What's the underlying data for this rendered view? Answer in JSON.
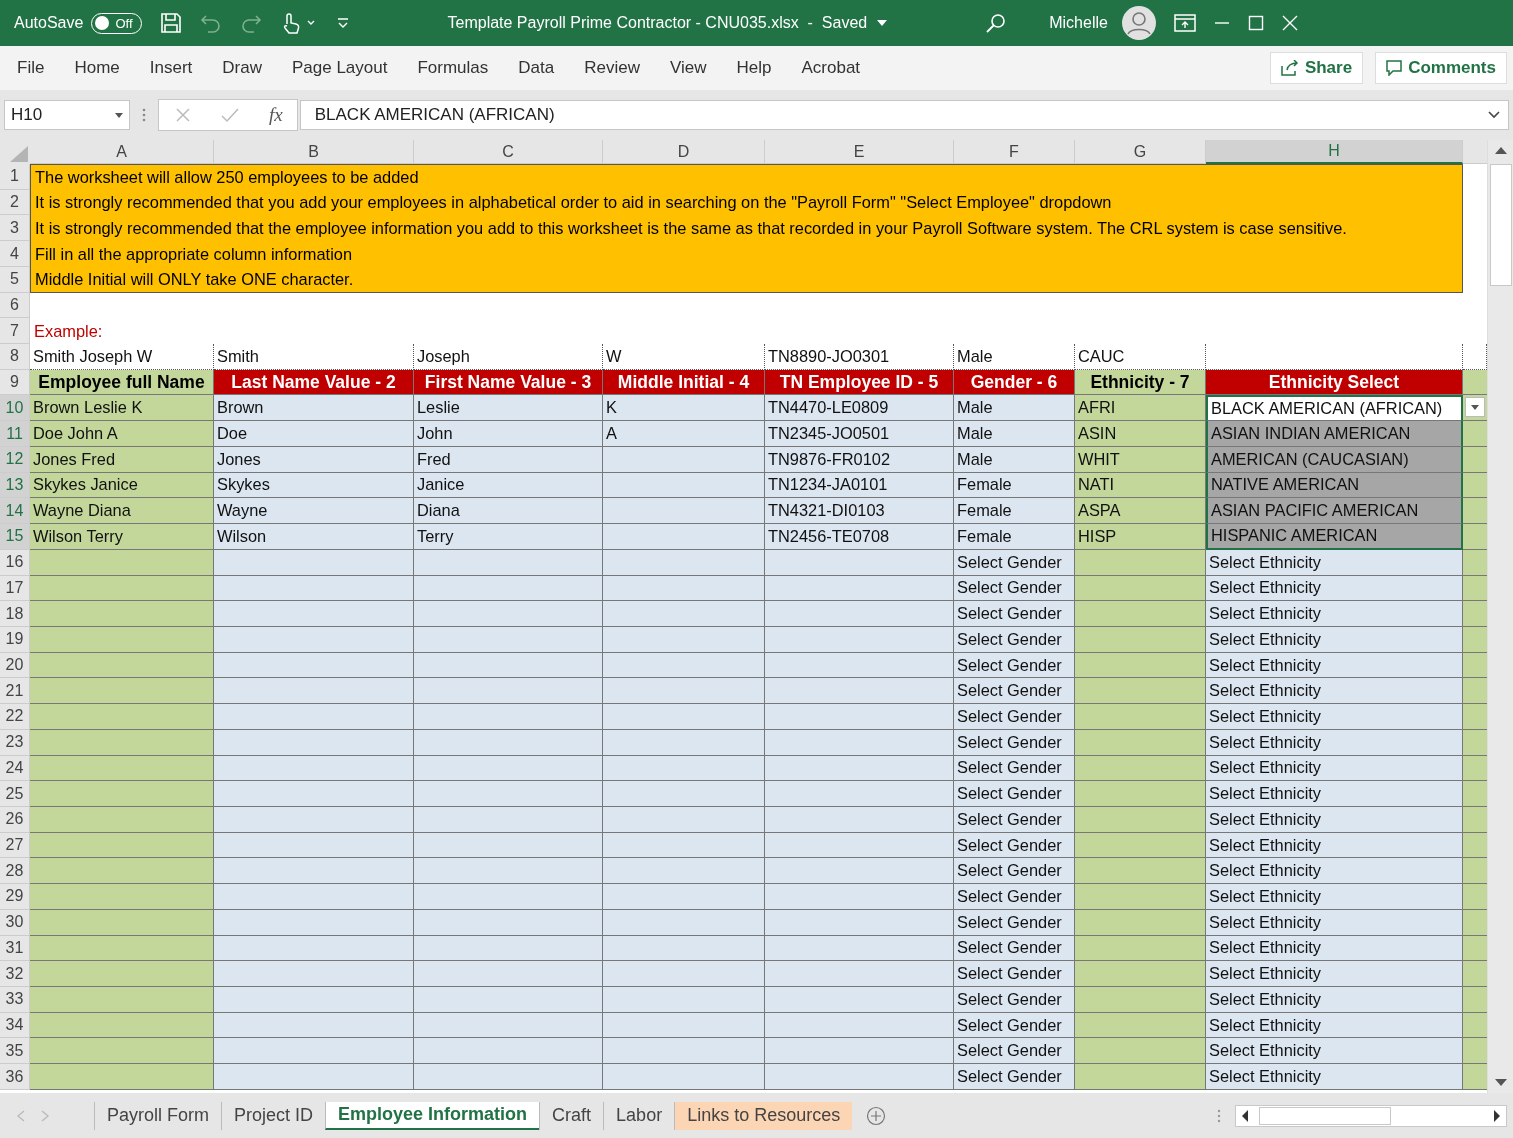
{
  "title_bar": {
    "autosave_label": "AutoSave",
    "autosave_toggle": {
      "label": "Off",
      "on": false
    },
    "title": "Template Payroll Prime Contractor - CNU035.xlsx  -  Saved",
    "user": "Michelle"
  },
  "ribbon": {
    "tabs": [
      {
        "label": "File",
        "selected": false
      },
      {
        "label": "Home",
        "selected": false
      },
      {
        "label": "Insert",
        "selected": false
      },
      {
        "label": "Draw",
        "selected": false
      },
      {
        "label": "Page Layout",
        "selected": false
      },
      {
        "label": "Formulas",
        "selected": false
      },
      {
        "label": "Data",
        "selected": false
      },
      {
        "label": "Review",
        "selected": false
      },
      {
        "label": "View",
        "selected": false
      },
      {
        "label": "Help",
        "selected": false
      },
      {
        "label": "Acrobat",
        "selected": false
      }
    ],
    "share": "Share",
    "comments": "Comments"
  },
  "formula_bar": {
    "name_box": "H10",
    "fx": "fx",
    "value": "BLACK AMERICAN (AFRICAN)"
  },
  "sheet": {
    "columns": [
      {
        "label": "A",
        "selected": false
      },
      {
        "label": "B",
        "selected": false
      },
      {
        "label": "C",
        "selected": false
      },
      {
        "label": "D",
        "selected": false
      },
      {
        "label": "E",
        "selected": false
      },
      {
        "label": "F",
        "selected": false
      },
      {
        "label": "G",
        "selected": false
      },
      {
        "label": "H",
        "selected": true
      }
    ],
    "rows": [
      {
        "num": "1",
        "kind": "note",
        "text": "The worksheet will allow 250 employees to be added"
      },
      {
        "num": "2",
        "kind": "note",
        "text": "It is strongly recommended that you add your employees in alphabetical order to aid in searching on the \"Payroll Form\" \"Select Employee\" dropdown"
      },
      {
        "num": "3",
        "kind": "note",
        "text": "It is strongly recommended that the employee information you add to this worksheet is the same as that recorded in your Payroll Software system.  The CRL system is case sensitive."
      },
      {
        "num": "4",
        "kind": "note",
        "text": "Fill in all the appropriate column information"
      },
      {
        "num": "5",
        "kind": "note",
        "text": "Middle Initial will ONLY take ONE character."
      },
      {
        "num": "6",
        "kind": "blank"
      },
      {
        "num": "7",
        "kind": "label",
        "text": "Example:"
      },
      {
        "num": "8",
        "kind": "example",
        "cells": [
          "Smith Joseph W",
          "Smith",
          "Joseph",
          "W",
          "TN8890-JO0301",
          "Male",
          "CAUC",
          null
        ]
      },
      {
        "num": "9",
        "kind": "header",
        "cells": [
          {
            "text": "Employee full Name",
            "color": "#c4d79b"
          },
          {
            "text": "Last Name Value - 2",
            "color": "#c00000"
          },
          {
            "text": "First Name Value - 3",
            "color": "#c00000"
          },
          {
            "text": "Middle Initial - 4",
            "color": "#c00000"
          },
          {
            "text": "TN Employee ID - 5",
            "color": "#c00000"
          },
          {
            "text": "Gender - 6",
            "color": "#c00000"
          },
          {
            "text": "Ethnicity - 7",
            "color": "#c4d79b"
          },
          {
            "text": "Ethnicity Select",
            "color": "#c00000"
          }
        ]
      },
      {
        "num": "10",
        "kind": "data",
        "selected": true,
        "active": true,
        "cells": [
          "Brown Leslie K",
          "Brown",
          "Leslie",
          "K",
          "TN4470-LE0809",
          "Male",
          "AFRI",
          "BLACK AMERICAN (AFRICAN)"
        ]
      },
      {
        "num": "11",
        "kind": "data",
        "selected": true,
        "active": false,
        "cells": [
          "Doe John A",
          "Doe",
          "John",
          "A",
          "TN2345-JO0501",
          "Male",
          "ASIN",
          "ASIAN INDIAN AMERICAN"
        ]
      },
      {
        "num": "12",
        "kind": "data",
        "selected": true,
        "active": false,
        "cells": [
          "Jones Fred",
          "Jones",
          "Fred",
          null,
          "TN9876-FR0102",
          "Male",
          "WHIT",
          "AMERICAN (CAUCASIAN)"
        ]
      },
      {
        "num": "13",
        "kind": "data",
        "selected": true,
        "active": false,
        "cells": [
          "Skykes Janice",
          "Skykes",
          "Janice",
          null,
          "TN1234-JA0101",
          "Female",
          "NATI",
          "NATIVE AMERICAN"
        ]
      },
      {
        "num": "14",
        "kind": "data",
        "selected": true,
        "active": false,
        "cells": [
          "Wayne Diana",
          "Wayne",
          "Diana",
          null,
          "TN4321-DI0103",
          "Female",
          "ASPA",
          "ASIAN PACIFIC AMERICAN"
        ]
      },
      {
        "num": "15",
        "kind": "data",
        "selected": true,
        "active": false,
        "cells": [
          "Wilson Terry",
          "Wilson",
          "Terry",
          null,
          "TN2456-TE0708",
          "Female",
          "HISP",
          "HISPANIC AMERICAN"
        ]
      },
      {
        "num": "16",
        "kind": "data",
        "selected": false,
        "active": false,
        "cells": [
          null,
          null,
          null,
          null,
          null,
          "Select Gender",
          null,
          "Select Ethnicity"
        ]
      },
      {
        "num": "17",
        "kind": "data",
        "selected": false,
        "active": false,
        "cells": [
          null,
          null,
          null,
          null,
          null,
          "Select Gender",
          null,
          "Select Ethnicity"
        ]
      },
      {
        "num": "18",
        "kind": "data",
        "selected": false,
        "active": false,
        "cells": [
          null,
          null,
          null,
          null,
          null,
          "Select Gender",
          null,
          "Select Ethnicity"
        ]
      },
      {
        "num": "19",
        "kind": "data",
        "selected": false,
        "active": false,
        "cells": [
          null,
          null,
          null,
          null,
          null,
          "Select Gender",
          null,
          "Select Ethnicity"
        ]
      },
      {
        "num": "20",
        "kind": "data",
        "selected": false,
        "active": false,
        "cells": [
          null,
          null,
          null,
          null,
          null,
          "Select Gender",
          null,
          "Select Ethnicity"
        ]
      },
      {
        "num": "21",
        "kind": "data",
        "selected": false,
        "active": false,
        "cells": [
          null,
          null,
          null,
          null,
          null,
          "Select Gender",
          null,
          "Select Ethnicity"
        ]
      },
      {
        "num": "22",
        "kind": "data",
        "selected": false,
        "active": false,
        "cells": [
          null,
          null,
          null,
          null,
          null,
          "Select Gender",
          null,
          "Select Ethnicity"
        ]
      },
      {
        "num": "23",
        "kind": "data",
        "selected": false,
        "active": false,
        "cells": [
          null,
          null,
          null,
          null,
          null,
          "Select Gender",
          null,
          "Select Ethnicity"
        ]
      },
      {
        "num": "24",
        "kind": "data",
        "selected": false,
        "active": false,
        "cells": [
          null,
          null,
          null,
          null,
          null,
          "Select Gender",
          null,
          "Select Ethnicity"
        ]
      },
      {
        "num": "25",
        "kind": "data",
        "selected": false,
        "active": false,
        "cells": [
          null,
          null,
          null,
          null,
          null,
          "Select Gender",
          null,
          "Select Ethnicity"
        ]
      },
      {
        "num": "26",
        "kind": "data",
        "selected": false,
        "active": false,
        "cells": [
          null,
          null,
          null,
          null,
          null,
          "Select Gender",
          null,
          "Select Ethnicity"
        ]
      },
      {
        "num": "27",
        "kind": "data",
        "selected": false,
        "active": false,
        "cells": [
          null,
          null,
          null,
          null,
          null,
          "Select Gender",
          null,
          "Select Ethnicity"
        ]
      },
      {
        "num": "28",
        "kind": "data",
        "selected": false,
        "active": false,
        "cells": [
          null,
          null,
          null,
          null,
          null,
          "Select Gender",
          null,
          "Select Ethnicity"
        ]
      },
      {
        "num": "29",
        "kind": "data",
        "selected": false,
        "active": false,
        "cells": [
          null,
          null,
          null,
          null,
          null,
          "Select Gender",
          null,
          "Select Ethnicity"
        ]
      },
      {
        "num": "30",
        "kind": "data",
        "selected": false,
        "active": false,
        "cells": [
          null,
          null,
          null,
          null,
          null,
          "Select Gender",
          null,
          "Select Ethnicity"
        ]
      },
      {
        "num": "31",
        "kind": "data",
        "selected": false,
        "active": false,
        "cells": [
          null,
          null,
          null,
          null,
          null,
          "Select Gender",
          null,
          "Select Ethnicity"
        ]
      },
      {
        "num": "32",
        "kind": "data",
        "selected": false,
        "active": false,
        "cells": [
          null,
          null,
          null,
          null,
          null,
          "Select Gender",
          null,
          "Select Ethnicity"
        ]
      },
      {
        "num": "33",
        "kind": "data",
        "selected": false,
        "active": false,
        "cells": [
          null,
          null,
          null,
          null,
          null,
          "Select Gender",
          null,
          "Select Ethnicity"
        ]
      },
      {
        "num": "34",
        "kind": "data",
        "selected": false,
        "active": false,
        "cells": [
          null,
          null,
          null,
          null,
          null,
          "Select Gender",
          null,
          "Select Ethnicity"
        ]
      },
      {
        "num": "35",
        "kind": "data",
        "selected": false,
        "active": false,
        "cells": [
          null,
          null,
          null,
          null,
          null,
          "Select Gender",
          null,
          "Select Ethnicity"
        ]
      },
      {
        "num": "36",
        "kind": "data",
        "selected": false,
        "active": false,
        "cells": [
          null,
          null,
          null,
          null,
          null,
          "Select Gender",
          null,
          "Select Ethnicity"
        ]
      }
    ]
  },
  "sheet_tabs": [
    {
      "label": "Payroll Form",
      "selected": false
    },
    {
      "label": "Project ID",
      "selected": false
    },
    {
      "label": "Employee Information",
      "selected": true
    },
    {
      "label": "Craft",
      "selected": false
    },
    {
      "label": "Labor",
      "selected": false
    },
    {
      "label": "Links to Resources",
      "selected": false,
      "color": "#fcd5b4"
    }
  ]
}
